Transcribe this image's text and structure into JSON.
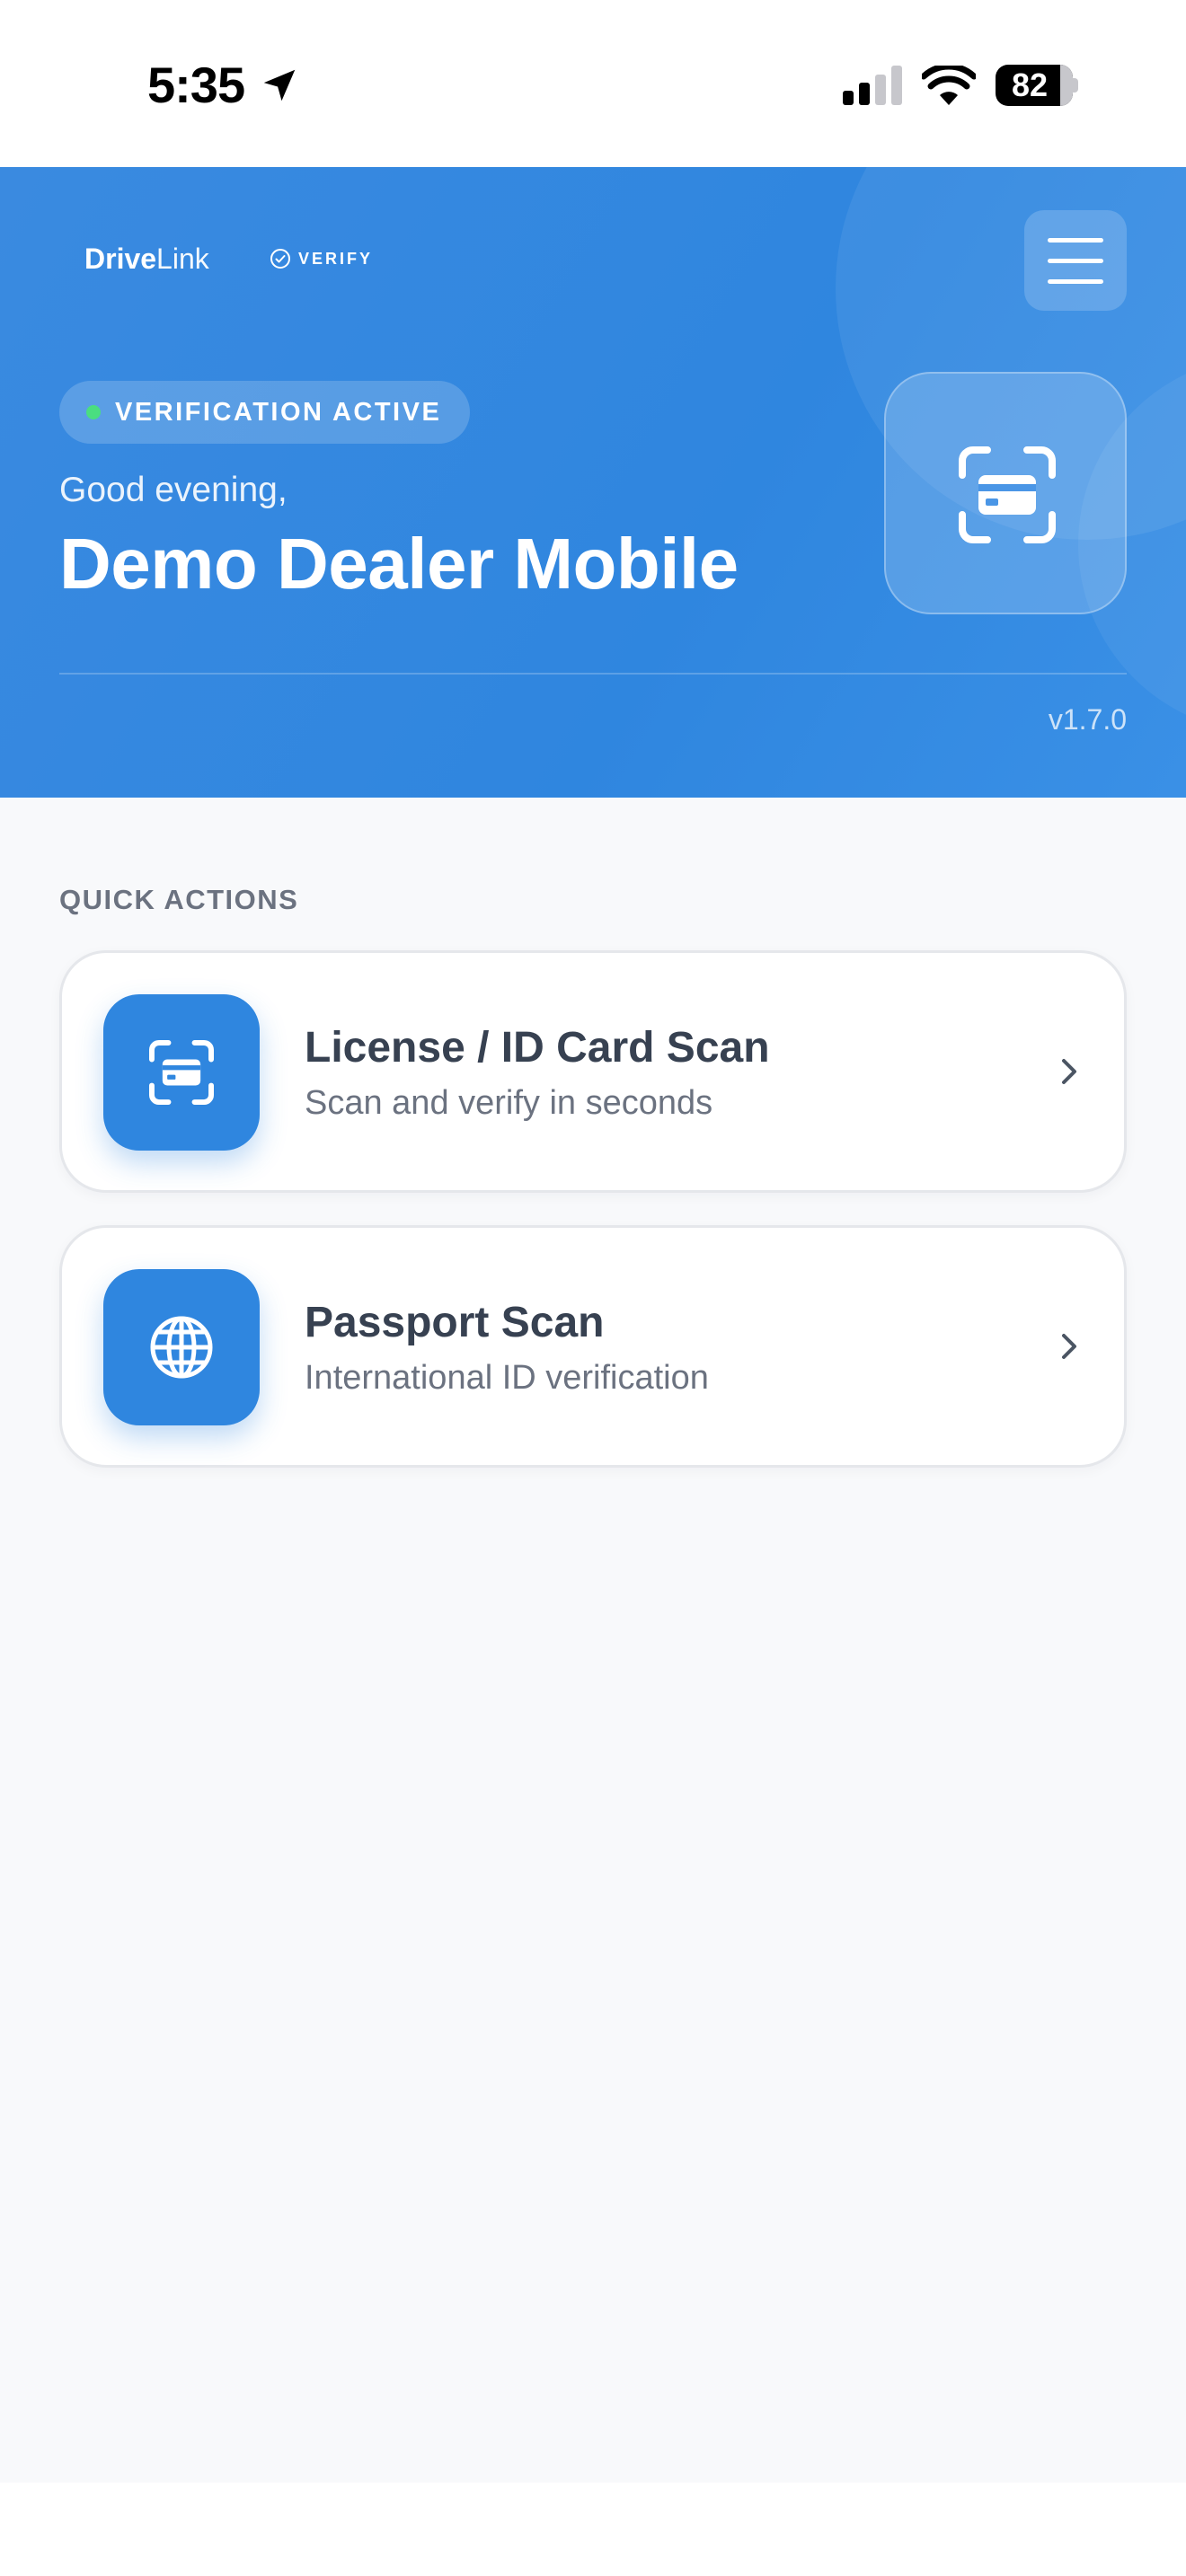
{
  "status_bar": {
    "time": "5:35",
    "battery": "82",
    "icons": [
      "location-arrow-icon",
      "cellular-signal-icon",
      "wifi-icon",
      "battery-icon"
    ]
  },
  "header": {
    "brand_bold": "Drive",
    "brand_light": "Link",
    "verify_label": "VERIFY",
    "menu_icon": "hamburger-menu-icon",
    "status_pill": "VERIFICATION ACTIVE",
    "greeting": "Good evening,",
    "dealer_name": "Demo Dealer Mobile",
    "hero_icon": "card-scan-icon",
    "version": "v1.7.0"
  },
  "quick_actions": {
    "title": "QUICK ACTIONS",
    "items": [
      {
        "title": "License / ID Card Scan",
        "subtitle": "Scan and verify in seconds",
        "icon": "card-scan-icon"
      },
      {
        "title": "Passport Scan",
        "subtitle": "International ID verification",
        "icon": "globe-icon"
      }
    ]
  },
  "colors": {
    "primary": "#2f86df",
    "status_dot": "#4ade80",
    "background": "#f8f9fb",
    "text_dark": "#374151",
    "text_muted": "#6b7280"
  }
}
